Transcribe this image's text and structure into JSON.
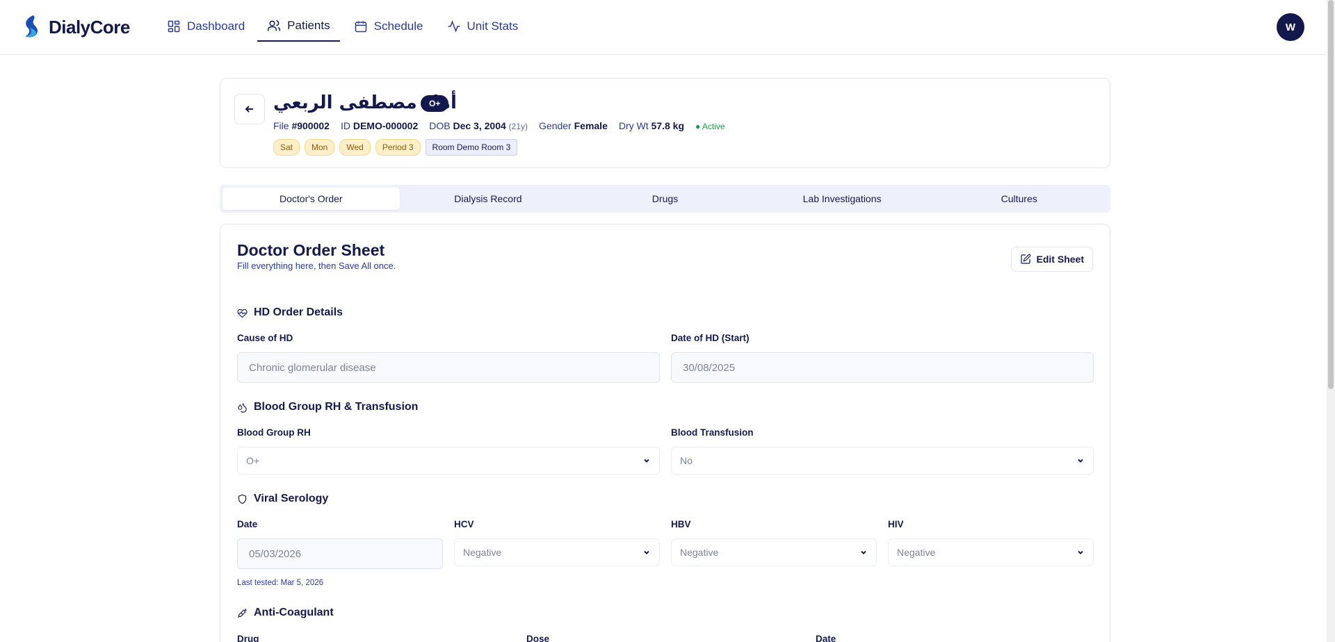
{
  "app": {
    "name": "DialyCore"
  },
  "nav": [
    {
      "label": "Dashboard",
      "icon": "grid-icon",
      "active": false
    },
    {
      "label": "Patients",
      "icon": "users-icon",
      "active": true
    },
    {
      "label": "Schedule",
      "icon": "calendar-icon",
      "active": false
    },
    {
      "label": "Unit Stats",
      "icon": "activity-icon",
      "active": false
    }
  ],
  "user": {
    "initial": "W"
  },
  "patient": {
    "name": "أمل مصطفى الربعي",
    "blood_group": "O+",
    "file_label": "File",
    "file_no": "#900002",
    "id_label": "ID",
    "id_value": "DEMO-000002",
    "dob_label": "DOB",
    "dob_value": "Dec 3, 2004",
    "age": "(21y)",
    "gender_label": "Gender",
    "gender_value": "Female",
    "drywt_label": "Dry Wt",
    "drywt_value": "57.8 kg",
    "status": "● Active",
    "schedule_chips": [
      "Sat",
      "Mon",
      "Wed",
      "Period 3"
    ],
    "room": "Room Demo Room 3"
  },
  "tabs": [
    "Doctor's Order",
    "Dialysis Record",
    "Drugs",
    "Lab Investigations",
    "Cultures"
  ],
  "sheet": {
    "title": "Doctor Order Sheet",
    "subtitle": "Fill everything here, then Save All once.",
    "edit_label": "Edit Sheet"
  },
  "hd_order": {
    "heading": "HD Order Details",
    "cause_label": "Cause of HD",
    "cause_value": "Chronic glomerular disease",
    "date_label": "Date of HD (Start)",
    "date_value": "30/08/2025"
  },
  "blood": {
    "heading": "Blood Group RH & Transfusion",
    "group_label": "Blood Group RH",
    "group_value": "O+",
    "transfusion_label": "Blood Transfusion",
    "transfusion_value": "No"
  },
  "serology": {
    "heading": "Viral Serology",
    "date_label": "Date",
    "date_value": "05/03/2026",
    "hcv_label": "HCV",
    "hcv_value": "Negative",
    "hbv_label": "HBV",
    "hbv_value": "Negative",
    "hiv_label": "HIV",
    "hiv_value": "Negative",
    "last_tested": "Last tested: Mar 5, 2026"
  },
  "anticoag": {
    "heading": "Anti-Coagulant",
    "drug_label": "Drug",
    "dose_label": "Dose",
    "date_label": "Date"
  }
}
